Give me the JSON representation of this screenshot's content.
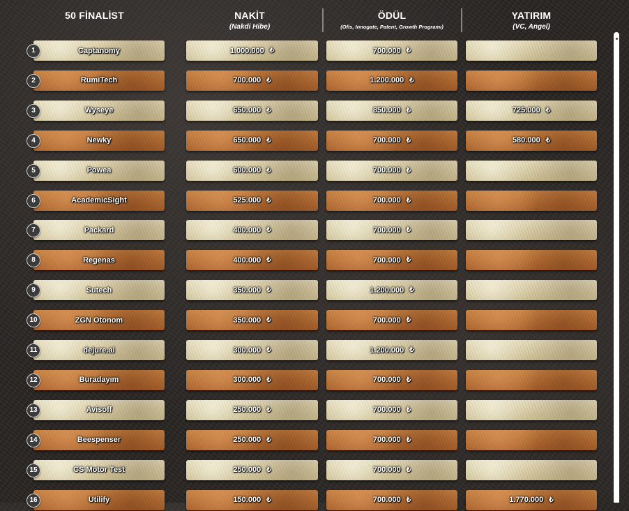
{
  "header": {
    "col1_title": "50 FİNALİST",
    "col2_title": "NAKİT",
    "col2_sub": "(Nakdi Hibe)",
    "col3_title": "ÖDÜL",
    "col3_sub": "(Ofis, Innogate, Patent, Growth Programı)",
    "col4_title": "YATIRIM",
    "col4_sub": "(VC, Angel)"
  },
  "currency_icon": "₺",
  "colors": {
    "light_tile": "#d7c9a1",
    "dark_tile": "#b8703a",
    "background": "#2a2624"
  },
  "rows": [
    {
      "rank": "1",
      "name": "Captanomy",
      "nakit": "1.000.000",
      "odul": "700.000",
      "yatirim": ""
    },
    {
      "rank": "2",
      "name": "RumiTech",
      "nakit": "700.000",
      "odul": "1.200.000",
      "yatirim": ""
    },
    {
      "rank": "3",
      "name": "Wyseye",
      "nakit": "650.000",
      "odul": "850.000",
      "yatirim": "725.000"
    },
    {
      "rank": "4",
      "name": "Newky",
      "nakit": "650.000",
      "odul": "700.000",
      "yatirim": "580.000"
    },
    {
      "rank": "5",
      "name": "Powea",
      "nakit": "600.000",
      "odul": "700.000",
      "yatirim": ""
    },
    {
      "rank": "6",
      "name": "AcademicSight",
      "nakit": "525.000",
      "odul": "700.000",
      "yatirim": ""
    },
    {
      "rank": "7",
      "name": "Packard",
      "nakit": "400.000",
      "odul": "700.000",
      "yatirim": ""
    },
    {
      "rank": "8",
      "name": "Regenas",
      "nakit": "400.000",
      "odul": "700.000",
      "yatirim": ""
    },
    {
      "rank": "9",
      "name": "Sutech",
      "nakit": "350.000",
      "odul": "1.200.000",
      "yatirim": ""
    },
    {
      "rank": "10",
      "name": "ZGN Otonom",
      "nakit": "350.000",
      "odul": "700.000",
      "yatirim": ""
    },
    {
      "rank": "11",
      "name": "dejure.ai",
      "nakit": "300.000",
      "odul": "1.200.000",
      "yatirim": ""
    },
    {
      "rank": "12",
      "name": "Buradayım",
      "nakit": "300.000",
      "odul": "700.000",
      "yatirim": ""
    },
    {
      "rank": "13",
      "name": "Avisoff",
      "nakit": "250.000",
      "odul": "700.000",
      "yatirim": ""
    },
    {
      "rank": "14",
      "name": "Beespenser",
      "nakit": "250.000",
      "odul": "700.000",
      "yatirim": ""
    },
    {
      "rank": "15",
      "name": "CS Motor Test",
      "nakit": "250.000",
      "odul": "700.000",
      "yatirim": ""
    },
    {
      "rank": "16",
      "name": "Utilify",
      "nakit": "150.000",
      "odul": "700.000",
      "yatirim": "1.770.000"
    }
  ]
}
